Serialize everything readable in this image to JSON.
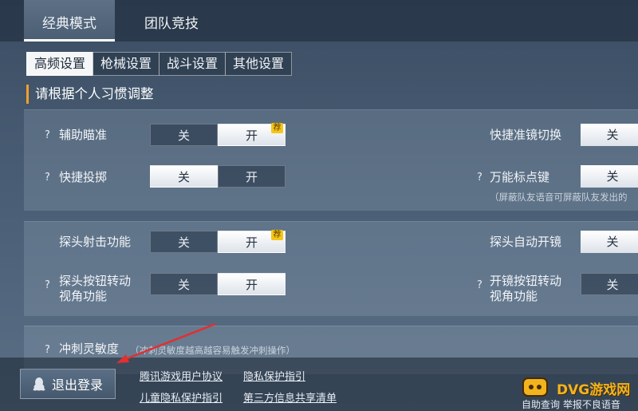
{
  "top_tabs": [
    "经典模式",
    "团队竞技"
  ],
  "sub_tabs": [
    "高频设置",
    "枪械设置",
    "战斗设置",
    "其他设置"
  ],
  "section_heading": "请根据个人习惯调整",
  "q": "?",
  "off": "关",
  "on": "开",
  "badge": "荐",
  "settings": {
    "aim_assist": "辅助瞄准",
    "quick_throw": "快捷投掷",
    "quick_scope_switch": "快捷准镜切换",
    "universal_marker": "万能标点键",
    "universal_marker_note": "（屏蔽队友语音可屏蔽队友发出的",
    "peek_fire": "探头射击功能",
    "peek_auto_scope": "探头自动开镜",
    "peek_button_rotate": [
      "探头按钮转动",
      "视角功能"
    ],
    "scope_button_rotate": [
      "开镜按钮转动",
      "视角功能"
    ],
    "sprint_sensitivity": "冲刺灵敏度",
    "sprint_note": "（冲刺灵敏度越高越容易触发冲刺操作）"
  },
  "footer": {
    "logout": "退出登录",
    "links": [
      "腾讯游戏用户协议",
      "隐私保护指引",
      "儿童隐私保护指引",
      "第三方信息共享清单"
    ],
    "watermark_brand": "DVG游戏网",
    "watermark_sub": "自助查询  举报不良语音"
  },
  "colors": {
    "accent": "#f0a02a",
    "badge": "#f5c518",
    "arrow": "#e03030"
  }
}
